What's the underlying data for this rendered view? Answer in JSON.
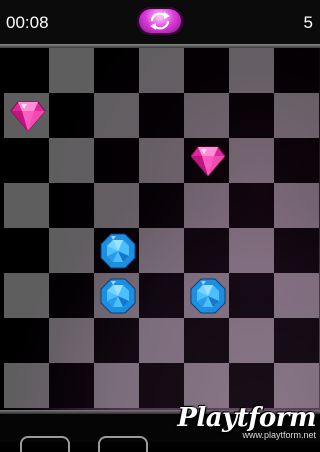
{
  "hud": {
    "timer": "00:08",
    "score": "5",
    "reset_icon": "circular-arrows-icon",
    "accent": "#d83bd8"
  },
  "board": {
    "columns": 7,
    "rows": 8,
    "gems": [
      {
        "type": "pink-diamond",
        "col": 0,
        "row": 1
      },
      {
        "type": "pink-diamond",
        "col": 4,
        "row": 2
      },
      {
        "type": "blue-octagon",
        "col": 2,
        "row": 4
      },
      {
        "type": "blue-octagon",
        "col": 2,
        "row": 5
      },
      {
        "type": "blue-octagon",
        "col": 4,
        "row": 5
      }
    ]
  },
  "watermark": {
    "brand": "Playtform",
    "url": "www.playtform.net"
  }
}
